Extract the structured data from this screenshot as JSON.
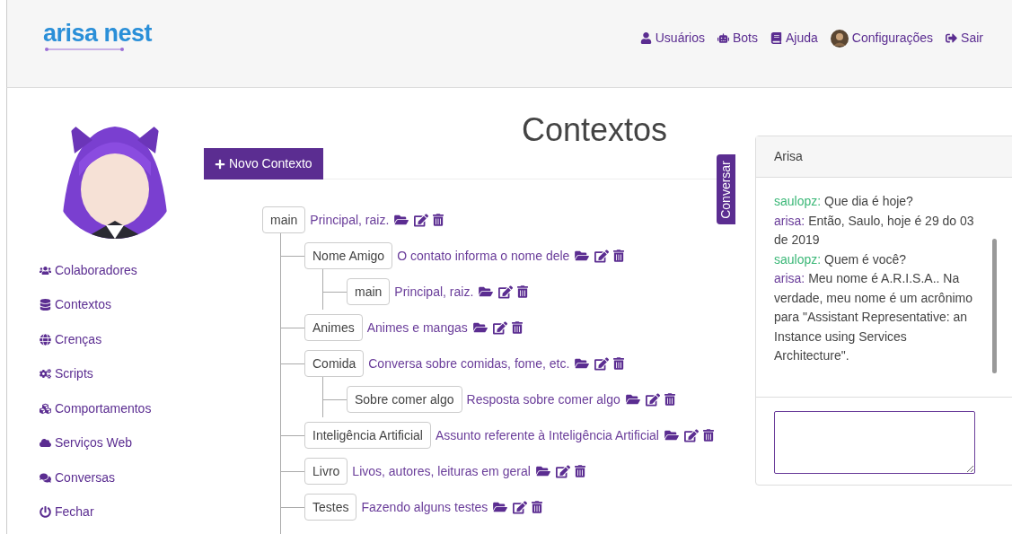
{
  "header": {
    "logo": "arisa nest",
    "nav": [
      {
        "label": "Usuários"
      },
      {
        "label": "Bots"
      },
      {
        "label": "Ajuda"
      },
      {
        "label": "Configurações"
      },
      {
        "label": "Sair"
      }
    ]
  },
  "sidebar": {
    "items": [
      {
        "label": "Colaboradores"
      },
      {
        "label": "Contextos"
      },
      {
        "label": "Crenças"
      },
      {
        "label": "Scripts"
      },
      {
        "label": "Comportamentos"
      },
      {
        "label": "Serviços Web"
      },
      {
        "label": "Conversas"
      },
      {
        "label": "Fechar"
      }
    ]
  },
  "page_title": "Contextos",
  "new_button": "Novo Contexto",
  "tree": [
    {
      "name": "main",
      "description": "Principal, raiz.",
      "children": [
        {
          "name": "Nome Amigo",
          "description": "O contato informa o nome dele",
          "children": [
            {
              "name": "main",
              "description": "Principal, raiz."
            }
          ]
        },
        {
          "name": "Animes",
          "description": "Animes e mangas"
        },
        {
          "name": "Comida",
          "description": "Conversa sobre comidas, fome, etc.",
          "children": [
            {
              "name": "Sobre comer algo",
              "description": "Resposta sobre comer algo"
            }
          ]
        },
        {
          "name": "Inteligência Artificial",
          "description": "Assunto referente à Inteligência Artificial"
        },
        {
          "name": "Livro",
          "description": "Livos, autores, leituras em geral"
        },
        {
          "name": "Testes",
          "description": "Fazendo alguns testes"
        }
      ]
    }
  ],
  "chat_tab": "Conversar",
  "chat": {
    "title": "Arisa",
    "messages": [
      {
        "kind": "user",
        "author": "saulopz:",
        "text": "Que dia é hoje?"
      },
      {
        "kind": "bot",
        "author": "arisa:",
        "text": "Então, Saulo, hoje é 29 do 03 de 2019"
      },
      {
        "kind": "user",
        "author": "saulopz:",
        "text": "Quem é você?"
      },
      {
        "kind": "bot",
        "author": "arisa:",
        "text": "Meu nome é A.R.I.S.A.. Na verdade, meu nome é um acrônimo para \"Assistant Representative: an Instance using Services Architecture\"."
      }
    ]
  }
}
